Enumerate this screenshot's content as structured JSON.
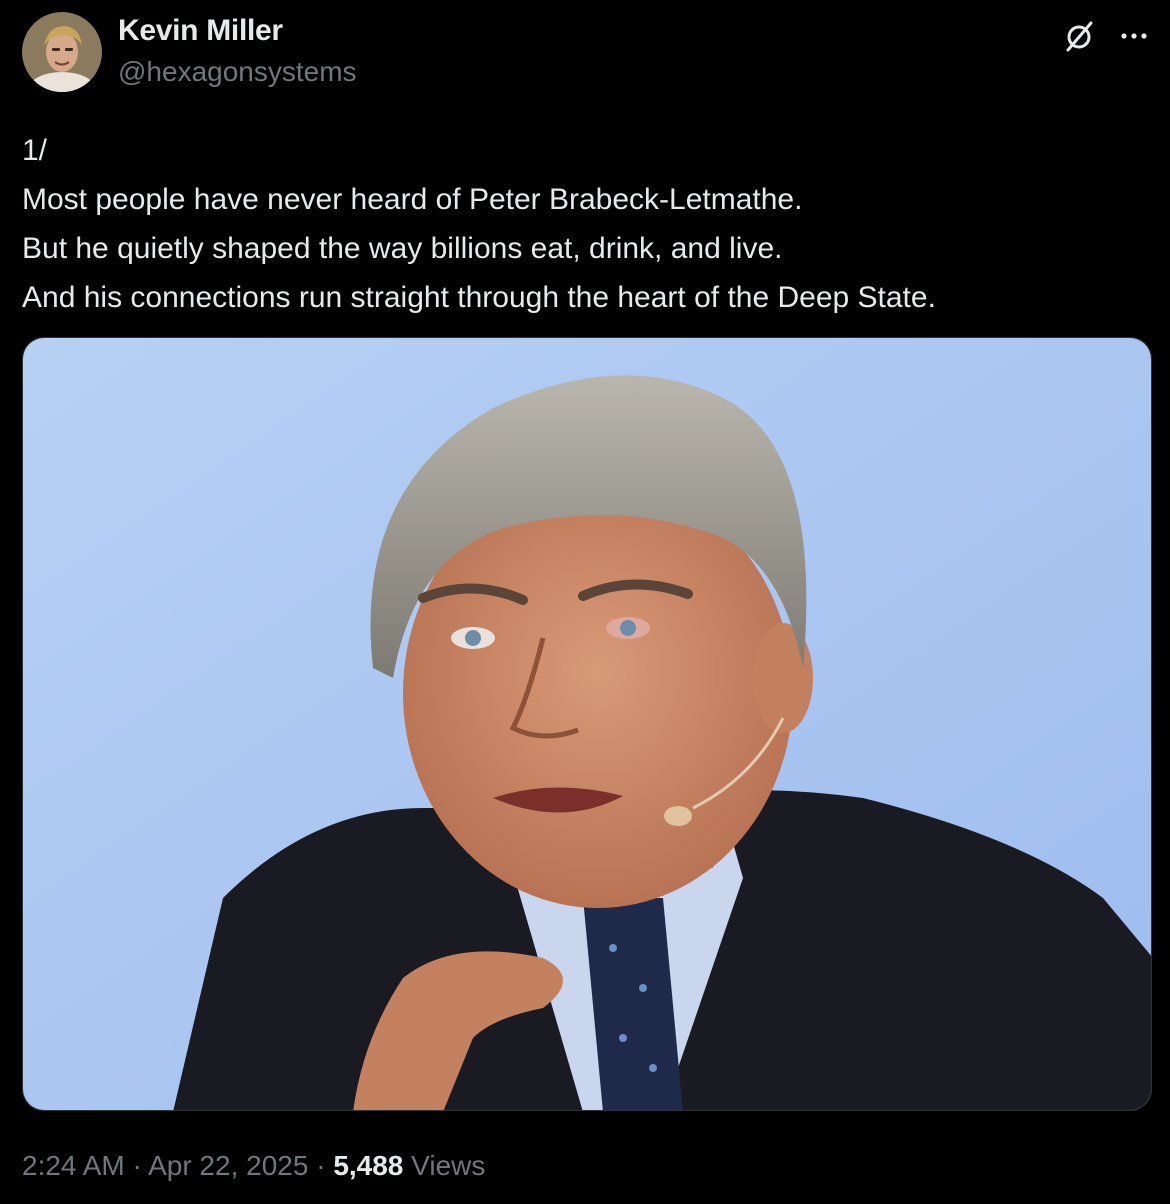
{
  "author": {
    "name": "Kevin Miller",
    "handle": "@hexagonsystems"
  },
  "icons": {
    "grok": "grok-slash-circle-icon",
    "more": "more-horizontal-icon"
  },
  "tweet": {
    "lines": [
      "1/",
      "Most people have never heard of Peter Brabeck-Letmathe.",
      "But he quietly shaped the way billions eat, drink, and live.",
      "And his connections run straight through the heart of the Deep State."
    ]
  },
  "meta": {
    "time": "2:24 AM",
    "separator": "·",
    "date": "Apr 22, 2025",
    "views_count": "5,488",
    "views_label": "Views"
  },
  "colors": {
    "background": "#000000",
    "text_primary": "#e7e9ea",
    "text_secondary": "#71767b",
    "photo_backdrop": "#a9c6f2"
  }
}
